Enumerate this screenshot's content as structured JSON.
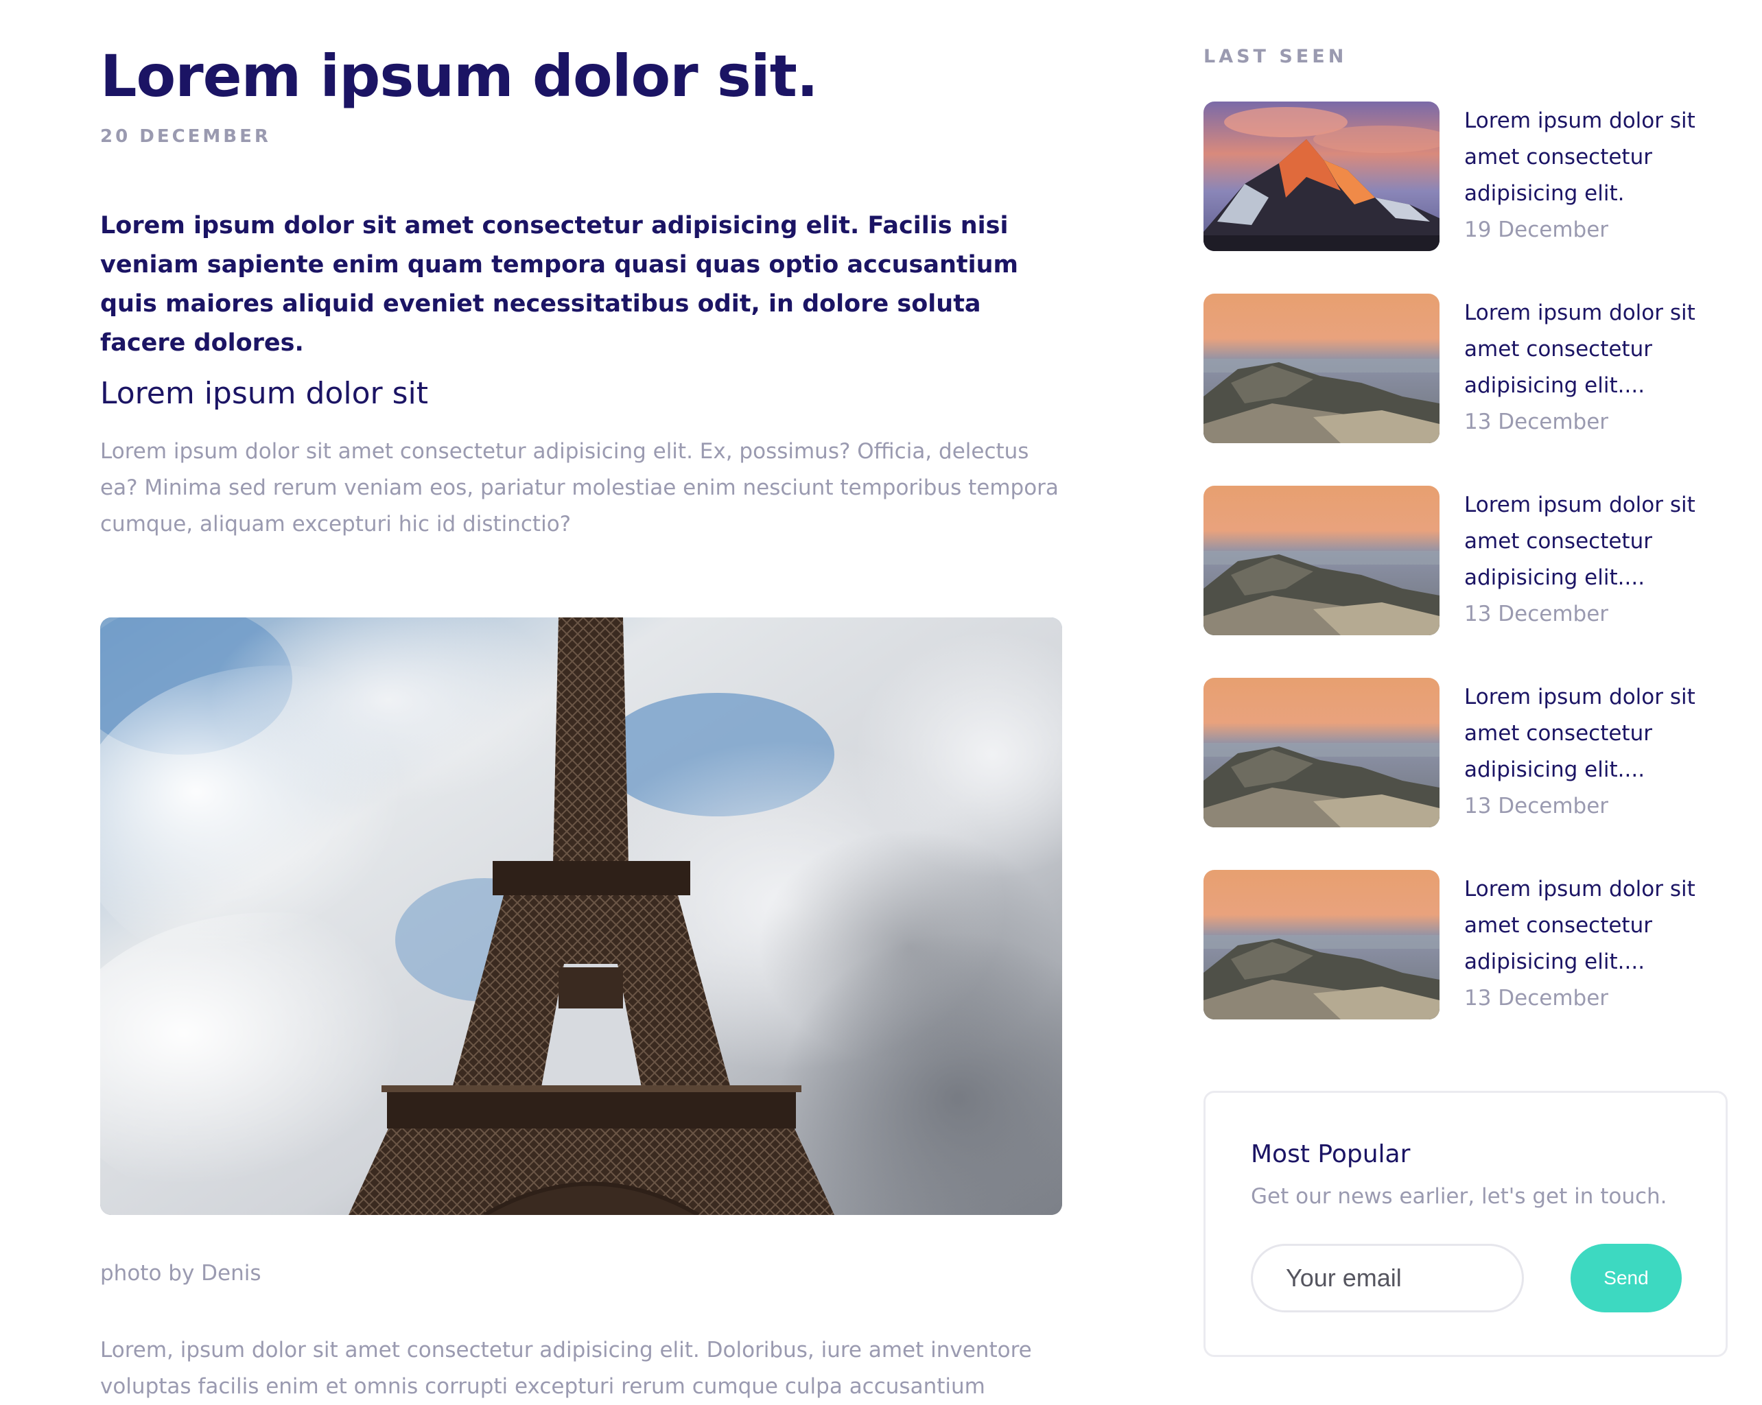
{
  "article": {
    "title": "Lorem ipsum dolor sit.",
    "date": "20 December",
    "lead": "Lorem ipsum dolor sit amet consectetur adipisicing elit. Facilis nisi veniam sapiente enim quam tempora quasi quas optio accusantium quis maiores aliquid eveniet necessitatibus odit, in dolore soluta facere dolores.",
    "subheading": "Lorem ipsum dolor sit",
    "body": "Lorem ipsum dolor sit amet consectetur adipisicing elit. Ex, possimus? Officia, delectus ea? Minima sed rerum veniam eos, pariatur molestiae enim nesciunt temporibus tempora cumque, aliquam excepturi hic id distinctio?",
    "photo_credit": "photo by Denis",
    "body_2": "Lorem, ipsum dolor sit amet consectetur adipisicing elit. Doloribus, iure amet inventore voluptas facilis enim et omnis corrupti excepturi rerum cumque culpa accusantium"
  },
  "sidebar": {
    "heading": "Last seen",
    "posts": [
      {
        "title": "Lorem ipsum dolor sit amet consectetur adipisicing elit.",
        "date": "19 December",
        "thumb": "mountain-peak"
      },
      {
        "title": "Lorem ipsum dolor sit amet consectetur adipisicing elit....",
        "date": "13 December",
        "thumb": "rocky-shore"
      },
      {
        "title": "Lorem ipsum dolor sit amet consectetur adipisicing elit....",
        "date": "13 December",
        "thumb": "rocky-shore"
      },
      {
        "title": "Lorem ipsum dolor sit amet consectetur adipisicing elit....",
        "date": "13 December",
        "thumb": "rocky-shore"
      },
      {
        "title": "Lorem ipsum dolor sit amet consectetur adipisicing elit....",
        "date": "13 December",
        "thumb": "rocky-shore"
      }
    ]
  },
  "newsletter": {
    "title": "Most Popular",
    "subtitle": "Get our news earlier, let's get in touch.",
    "email_placeholder": "Your email",
    "send_label": "Send"
  },
  "colors": {
    "heading": "#1b1464",
    "muted": "#9a9ab0",
    "accent": "#3dd9c1",
    "border": "#ebebf0"
  }
}
